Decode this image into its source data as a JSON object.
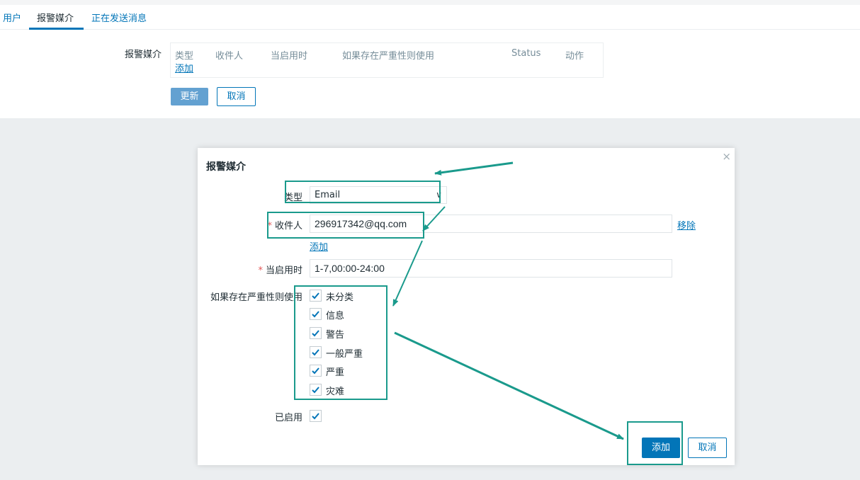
{
  "tabs": [
    {
      "label": "用户"
    },
    {
      "label": "报警媒介"
    },
    {
      "label": "正在发送消息"
    }
  ],
  "media_section": {
    "row_label": "报警媒介",
    "columns": [
      "类型",
      "收件人",
      "当启用时",
      "如果存在严重性则使用",
      "Status",
      "动作"
    ],
    "add_link": "添加",
    "update_button": "更新",
    "cancel_button": "取消"
  },
  "dialog": {
    "title": "报警媒介",
    "close_glyph": "×",
    "type_label": "类型",
    "type_value": "Email",
    "recipient_label": "收件人",
    "recipient_value": "296917342@qq.com",
    "remove_link": "移除",
    "add_link": "添加",
    "when_active_label": "当启用时",
    "when_active_value": "1-7,00:00-24:00",
    "severity_label": "如果存在严重性则使用",
    "severities": [
      {
        "label": "未分类",
        "checked": true
      },
      {
        "label": "信息",
        "checked": true
      },
      {
        "label": "警告",
        "checked": true
      },
      {
        "label": "一般严重",
        "checked": true
      },
      {
        "label": "严重",
        "checked": true
      },
      {
        "label": "灾难",
        "checked": true
      }
    ],
    "enabled_label": "已启用",
    "enabled_checked": true,
    "add_button": "添加",
    "cancel_button": "取消"
  },
  "colors": {
    "accent": "#0275b8",
    "annotation": "#1a9a8c",
    "required": "#e45959"
  }
}
